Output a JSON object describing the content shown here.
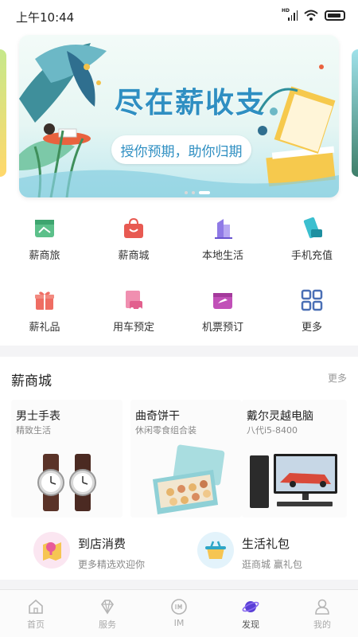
{
  "status_bar": {
    "time": "上午10:44",
    "signal_label": "HD"
  },
  "banner": {
    "title": "尽在薪收支",
    "subtitle": "授你预期，助你归期",
    "page_count": 3,
    "active_page": 3
  },
  "services": [
    {
      "label": "薪商旅",
      "icon": "travel-icon"
    },
    {
      "label": "薪商城",
      "icon": "shop-bag-icon"
    },
    {
      "label": "本地生活",
      "icon": "building-icon"
    },
    {
      "label": "手机充值",
      "icon": "phone-recharge-icon"
    },
    {
      "label": "薪礼品",
      "icon": "gift-icon"
    },
    {
      "label": "用车预定",
      "icon": "car-booking-icon"
    },
    {
      "label": "机票预订",
      "icon": "flight-ticket-icon"
    },
    {
      "label": "更多",
      "icon": "grid-more-icon"
    }
  ],
  "shop": {
    "title": "薪商城",
    "more": "更多",
    "products": [
      {
        "name": "男士手表",
        "subtitle": "精致生活"
      },
      {
        "name": "曲奇饼干",
        "subtitle": "休闲零食组合装"
      },
      {
        "name": "戴尔灵越电脑",
        "subtitle": "八代i5-8400"
      }
    ],
    "promos": [
      {
        "title": "到店消费",
        "subtitle": "更多精选欢迎你",
        "icon": "map-pin-icon"
      },
      {
        "title": "生活礼包",
        "subtitle": "逛商城 赢礼包",
        "icon": "basket-icon"
      }
    ]
  },
  "nav": {
    "items": [
      {
        "label": "首页",
        "icon": "home-icon"
      },
      {
        "label": "服务",
        "icon": "diamond-icon"
      },
      {
        "label": "IM",
        "icon": "im-icon"
      },
      {
        "label": "发现",
        "icon": "planet-icon"
      },
      {
        "label": "我的",
        "icon": "user-icon"
      }
    ],
    "active": "发现"
  },
  "colors": {
    "accent": "#2f8fc2",
    "active_nav": "#5a3fd6",
    "background": "#f4f4f6"
  }
}
